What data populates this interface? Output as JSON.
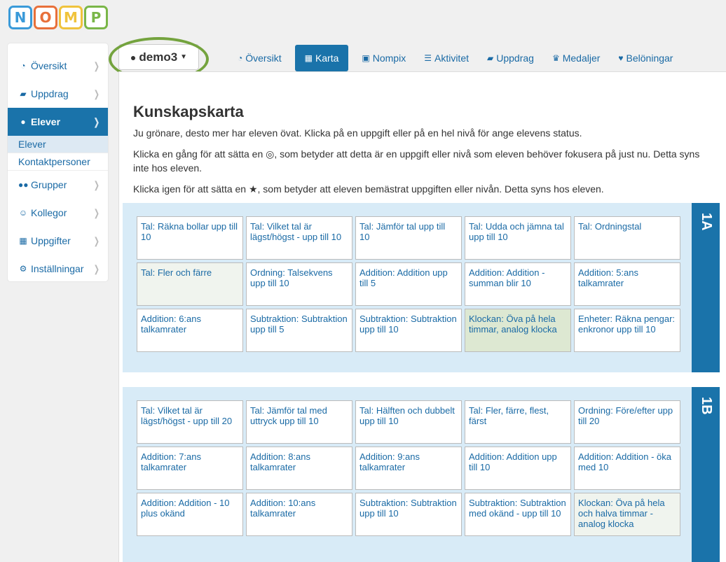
{
  "logo": {
    "letters": [
      "N",
      "O",
      "M",
      "P"
    ],
    "colors": [
      "#3a9ad9",
      "#e8703a",
      "#f0c33c",
      "#7ab648"
    ]
  },
  "sidebar": {
    "items": [
      {
        "icon": "dashboard-icon",
        "label": "Översikt"
      },
      {
        "icon": "book-icon",
        "label": "Uppdrag"
      },
      {
        "icon": "user-icon",
        "label": "Elever",
        "active": true
      },
      {
        "icon": "users-icon",
        "label": "Grupper"
      },
      {
        "icon": "smile-icon",
        "label": "Kollegor"
      },
      {
        "icon": "grid-icon",
        "label": "Uppgifter"
      },
      {
        "icon": "gear-icon",
        "label": "Inställningar"
      }
    ],
    "subitems": [
      {
        "label": "Elever",
        "selected": true
      },
      {
        "label": "Kontaktpersoner"
      }
    ]
  },
  "user": {
    "name": "demo3"
  },
  "tabs": [
    {
      "icon": "dashboard-icon",
      "label": "Översikt"
    },
    {
      "icon": "grid-icon",
      "label": "Karta",
      "active": true
    },
    {
      "icon": "money-icon",
      "label": "Nompix"
    },
    {
      "icon": "list-icon",
      "label": "Aktivitet"
    },
    {
      "icon": "book-icon",
      "label": "Uppdrag"
    },
    {
      "icon": "trophy-icon",
      "label": "Medaljer"
    },
    {
      "icon": "heart-icon",
      "label": "Belöningar"
    }
  ],
  "page": {
    "title": "Kunskapskarta",
    "intro": "Ju grönare, desto mer har eleven övat. Klicka på en uppgift eller på en hel nivå för ange elevens status.",
    "focus_line1": "Klicka en gång för att sätta en ◎, som betyder att detta är en uppgift eller nivå som eleven behöver fokusera på just nu. Detta syns",
    "focus_line2": "inte hos eleven.",
    "star_line": "Klicka igen för att sätta en ★, som betyder att eleven bemästrat uppgiften eller nivån. Detta syns hos eleven."
  },
  "levels": [
    {
      "name": "1A",
      "tasks": [
        {
          "label": "Tal: Räkna bollar upp till 10",
          "status": "none"
        },
        {
          "label": "Tal: Vilket tal är lägst/högst - upp till 10",
          "status": "none"
        },
        {
          "label": "Tal: Jämför tal upp till 10",
          "status": "none"
        },
        {
          "label": "Tal: Udda och jämna tal upp till 10",
          "status": "none"
        },
        {
          "label": "Tal: Ordningstal",
          "status": "none"
        },
        {
          "label": "Tal: Fler och färre",
          "status": "light"
        },
        {
          "label": "Ordning: Talsekvens upp till 10",
          "status": "none"
        },
        {
          "label": "Addition: Addition upp till 5",
          "status": "none"
        },
        {
          "label": "Addition: Addition - summan blir 10",
          "status": "none"
        },
        {
          "label": "Addition: 5:ans talkamrater",
          "status": "none"
        },
        {
          "label": "Addition: 6:ans talkamrater",
          "status": "none"
        },
        {
          "label": "Subtraktion: Subtraktion upp till 5",
          "status": "none"
        },
        {
          "label": "Subtraktion: Subtraktion upp till 10",
          "status": "none"
        },
        {
          "label": "Klockan: Öva på hela timmar, analog klocka",
          "status": "green"
        },
        {
          "label": "Enheter: Räkna pengar: enkronor upp till 10",
          "status": "none"
        }
      ]
    },
    {
      "name": "1B",
      "tasks": [
        {
          "label": "Tal: Vilket tal är lägst/högst - upp till 20",
          "status": "none"
        },
        {
          "label": "Tal: Jämför tal med uttryck upp till 10",
          "status": "none"
        },
        {
          "label": "Tal: Hälften och dubbelt upp till 10",
          "status": "none"
        },
        {
          "label": "Tal: Fler, färre, flest, färst",
          "status": "none"
        },
        {
          "label": "Ordning: Före/efter upp till 20",
          "status": "none"
        },
        {
          "label": "Addition: 7:ans talkamrater",
          "status": "none"
        },
        {
          "label": "Addition: 8:ans talkamrater",
          "status": "none"
        },
        {
          "label": "Addition: 9:ans talkamrater",
          "status": "none"
        },
        {
          "label": "Addition: Addition upp till 10",
          "status": "none"
        },
        {
          "label": "Addition: Addition - öka med 10",
          "status": "none"
        },
        {
          "label": "Addition: Addition - 10 plus okänd",
          "status": "none"
        },
        {
          "label": "Addition: 10:ans talkamrater",
          "status": "none"
        },
        {
          "label": "Subtraktion: Subtraktion upp till 10",
          "status": "none"
        },
        {
          "label": "Subtraktion: Subtraktion med okänd - upp till 10",
          "status": "none"
        },
        {
          "label": "Klockan: Öva på hela och halva timmar - analog klocka",
          "status": "light"
        }
      ]
    }
  ]
}
